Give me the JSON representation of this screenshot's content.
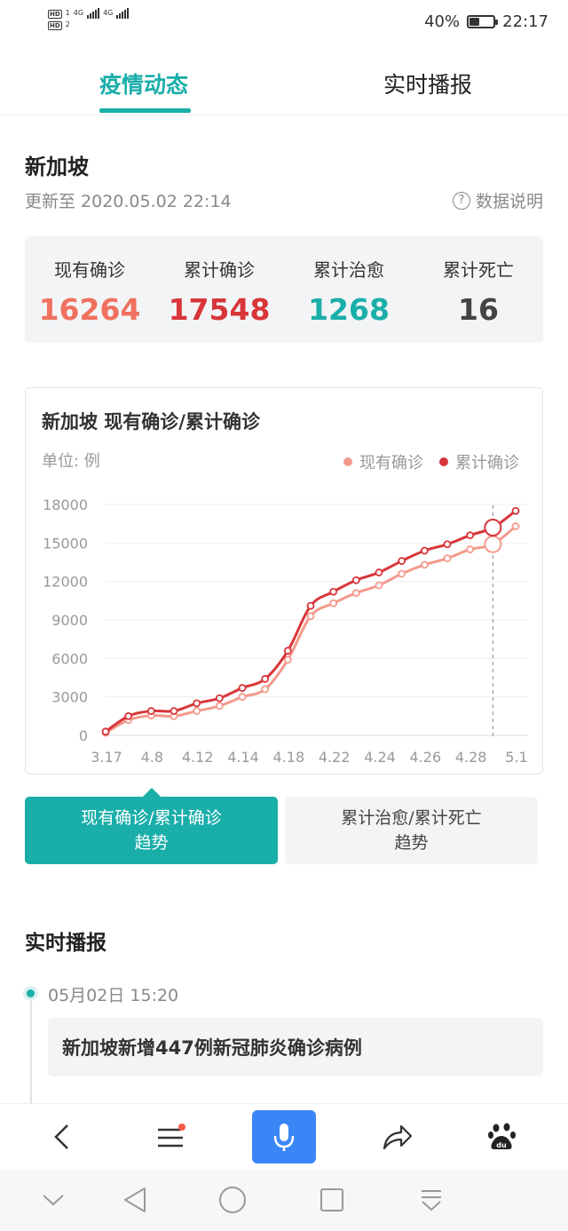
{
  "status": {
    "sim_labels": [
      "HD",
      "HD"
    ],
    "sim_sub": [
      "1",
      "2"
    ],
    "network": [
      "4G",
      "4G"
    ],
    "battery": "40%",
    "battery_level": 0.4,
    "time": "22:17"
  },
  "tabs": [
    {
      "label": "疫情动态",
      "active": true
    },
    {
      "label": "实时播报",
      "active": false
    }
  ],
  "header": {
    "country": "新加坡",
    "update_time": "更新至 2020.05.02 22:14",
    "data_note": "数据说明"
  },
  "stats": [
    {
      "label": "现有确诊",
      "value": "16264",
      "color": "#f0715f"
    },
    {
      "label": "累计确诊",
      "value": "17548",
      "color": "#d8363a"
    },
    {
      "label": "累计治愈",
      "value": "1268",
      "color": "#1aaea9"
    },
    {
      "label": "累计死亡",
      "value": "16",
      "color": "#444444"
    }
  ],
  "chart": {
    "title": "新加坡 现有确诊/累计确诊",
    "unit": "单位: 例"
  },
  "chart_data": {
    "type": "line",
    "title": "新加坡 现有确诊/累计确诊",
    "ylabel": "单位: 例",
    "ylim": [
      0,
      18000
    ],
    "y_ticks": [
      0,
      3000,
      6000,
      9000,
      12000,
      15000,
      18000
    ],
    "x_tick_labels": [
      "3.17",
      "4.8",
      "4.12",
      "4.14",
      "4.18",
      "4.22",
      "4.24",
      "4.26",
      "4.28",
      "5.1"
    ],
    "legend_position": "top-right",
    "grid": true,
    "series": [
      {
        "name": "现有确诊",
        "color": "#f39a8c",
        "values": [
          200,
          1200,
          1550,
          1500,
          1900,
          2300,
          3000,
          3600,
          5900,
          9300,
          10300,
          11100,
          11700,
          12600,
          13300,
          13800,
          14500,
          14900,
          16300
        ]
      },
      {
        "name": "累计确诊",
        "color": "#d8363a",
        "values": [
          300,
          1500,
          1900,
          1900,
          2500,
          2900,
          3700,
          4400,
          6600,
          10100,
          11200,
          12100,
          12700,
          13600,
          14400,
          14900,
          15600,
          16200,
          17500
        ]
      }
    ]
  },
  "trend_buttons": [
    {
      "line1": "现有确诊/累计确诊",
      "line2": "趋势",
      "active": true
    },
    {
      "line1": "累计治愈/累计死亡",
      "line2": "趋势",
      "active": false
    }
  ],
  "live": {
    "section_title": "实时播报",
    "items": [
      {
        "time": "05月02日  15:20",
        "title": "新加坡新增447例新冠肺炎确诊病例"
      }
    ]
  },
  "toolbar": {
    "icons": [
      "back-icon",
      "menu-icon",
      "microphone-icon",
      "share-icon",
      "baidu-paw-icon"
    ]
  },
  "sysnav": {
    "icons": [
      "chevron-down-icon",
      "triangle-back-icon",
      "circle-home-icon",
      "square-recent-icon",
      "download-icon"
    ]
  }
}
